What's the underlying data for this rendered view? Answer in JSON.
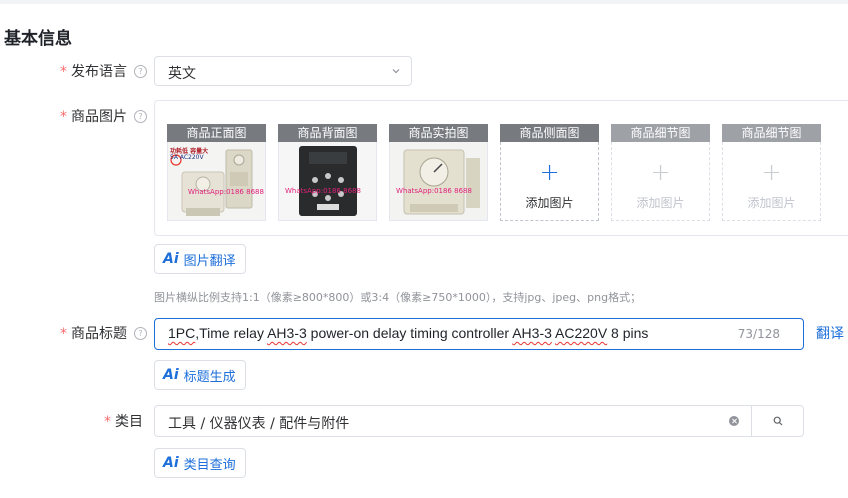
{
  "section_title": "基本信息",
  "required_mark": "*",
  "help_glyph": "?",
  "language": {
    "label": "发布语言",
    "value": "英文"
  },
  "images": {
    "label": "商品图片",
    "slots": [
      {
        "caption": "商品正面图",
        "type": "photo"
      },
      {
        "caption": "商品背面图",
        "type": "photo"
      },
      {
        "caption": "商品实拍图",
        "type": "photo"
      },
      {
        "caption": "商品侧面图",
        "type": "add",
        "add_label": "添加图片",
        "plus": "+"
      },
      {
        "caption": "商品细节图",
        "type": "add-disabled",
        "add_label": "添加图片",
        "plus": "+"
      },
      {
        "caption": "商品细节图",
        "type": "add-disabled",
        "add_label": "添加图片",
        "plus": "+"
      }
    ],
    "front_text_1": "功耗低 容量大",
    "front_text_2": "5A AC220V",
    "watermark": "WhatsApp:0186 8688",
    "translate_button": "图片翻译",
    "hint": "图片横纵比例支持1:1（像素≥800*800）或3:4（像素≥750*1000），支持jpg、jpeg、png格式；"
  },
  "ai_glyph": "Ai",
  "title": {
    "label": "商品标题",
    "part1": "1PC",
    "part2": ",Time relay ",
    "part3": "AH3-3",
    "part4": " power-on delay timing controller ",
    "part5": "AH3-3",
    "part6": " ",
    "part7": "AC220V",
    "part8": " 8 pins",
    "counter": "73/128",
    "translate_link": "翻译",
    "generate_button": "标题生成"
  },
  "category": {
    "label": "类目",
    "value": "工具 / 仪器仪表 / 配件与附件",
    "query_button": "类目查询"
  },
  "colors": {
    "accent": "#1e6fd9",
    "required": "#f56c6c"
  }
}
